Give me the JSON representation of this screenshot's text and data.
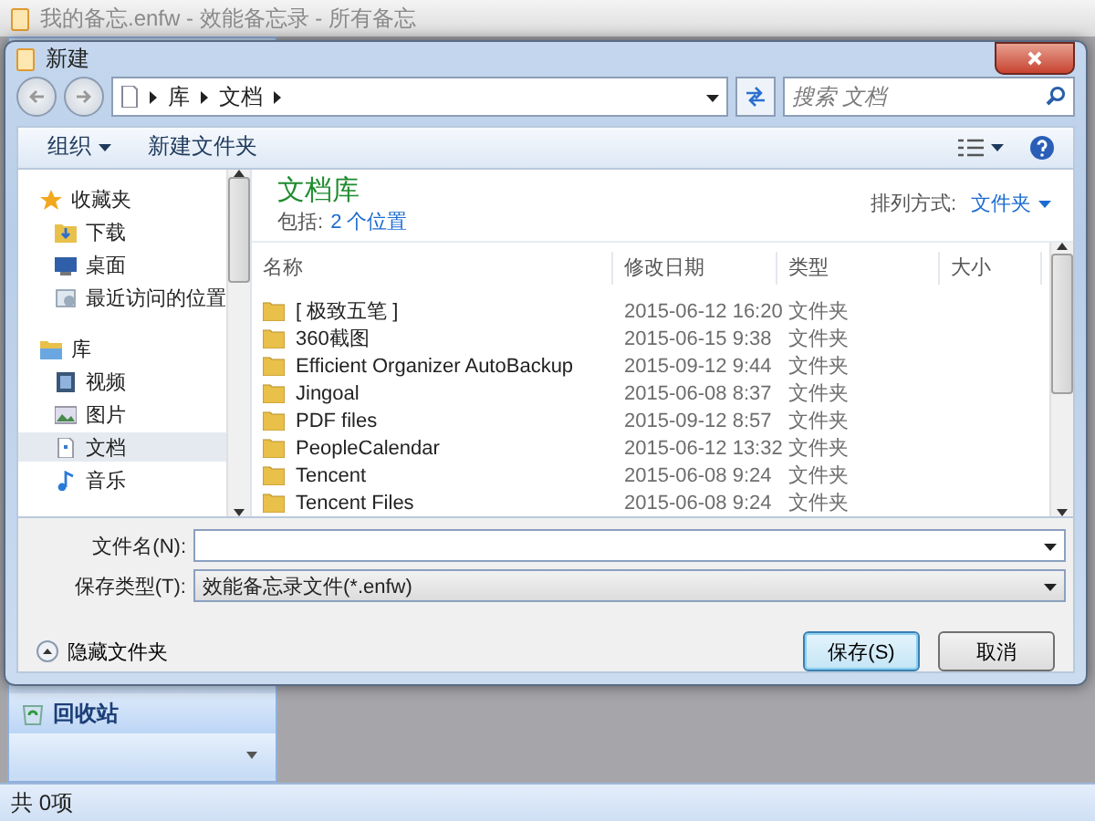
{
  "app": {
    "title": "我的备忘.enfw - 效能备忘录 - 所有备忘",
    "sidebar_items": [
      {
        "label": "回收站"
      }
    ],
    "status_bar": "共 0项"
  },
  "dialog": {
    "title": "新建",
    "breadcrumb": [
      "库",
      "文档"
    ],
    "search": {
      "placeholder": "搜索 文档"
    },
    "toolbar": [
      "组织",
      "新建文件夹"
    ],
    "nav": [
      {
        "label": "收藏夹",
        "selected": false,
        "children": [
          {
            "label": "下载",
            "selected": false
          },
          {
            "label": "桌面",
            "selected": false
          },
          {
            "label": "最近访问的位置",
            "selected": false
          }
        ]
      },
      {
        "label": "库",
        "selected": false,
        "children": [
          {
            "label": "视频",
            "selected": false
          },
          {
            "label": "图片",
            "selected": false
          },
          {
            "label": "文档",
            "selected": true
          },
          {
            "label": "音乐",
            "selected": false
          }
        ]
      }
    ],
    "library": {
      "title": "文档库",
      "includes_label": "包括:",
      "includes_link": "2 个位置",
      "arrange_label": "排列方式:",
      "arrange_value": "文件夹"
    },
    "columns": [
      "名称",
      "修改日期",
      "类型",
      "大小"
    ],
    "rows": [
      {
        "name": "[ 极致五笔 ]",
        "modified": "2015-06-12 16:20",
        "type": "文件夹"
      },
      {
        "name": "360截图",
        "modified": "2015-06-15 9:38",
        "type": "文件夹"
      },
      {
        "name": "Efficient Organizer AutoBackup",
        "modified": "2015-09-12 9:44",
        "type": "文件夹"
      },
      {
        "name": "Jingoal",
        "modified": "2015-06-08 8:37",
        "type": "文件夹"
      },
      {
        "name": "PDF files",
        "modified": "2015-09-12 8:57",
        "type": "文件夹"
      },
      {
        "name": "PeopleCalendar",
        "modified": "2015-06-12 13:32",
        "type": "文件夹"
      },
      {
        "name": "Tencent",
        "modified": "2015-06-08 9:24",
        "type": "文件夹"
      },
      {
        "name": "Tencent Files",
        "modified": "2015-06-08 9:24",
        "type": "文件夹"
      }
    ],
    "filename": {
      "label": "文件名(N):"
    },
    "filetype": {
      "label": "保存类型(T):",
      "value": "效能备忘录文件(*.enfw)"
    },
    "hide_folders": "隐藏文件夹",
    "buttons": [
      {
        "label": "保存(S)",
        "default": true
      },
      {
        "label": "取消",
        "default": false
      }
    ]
  }
}
